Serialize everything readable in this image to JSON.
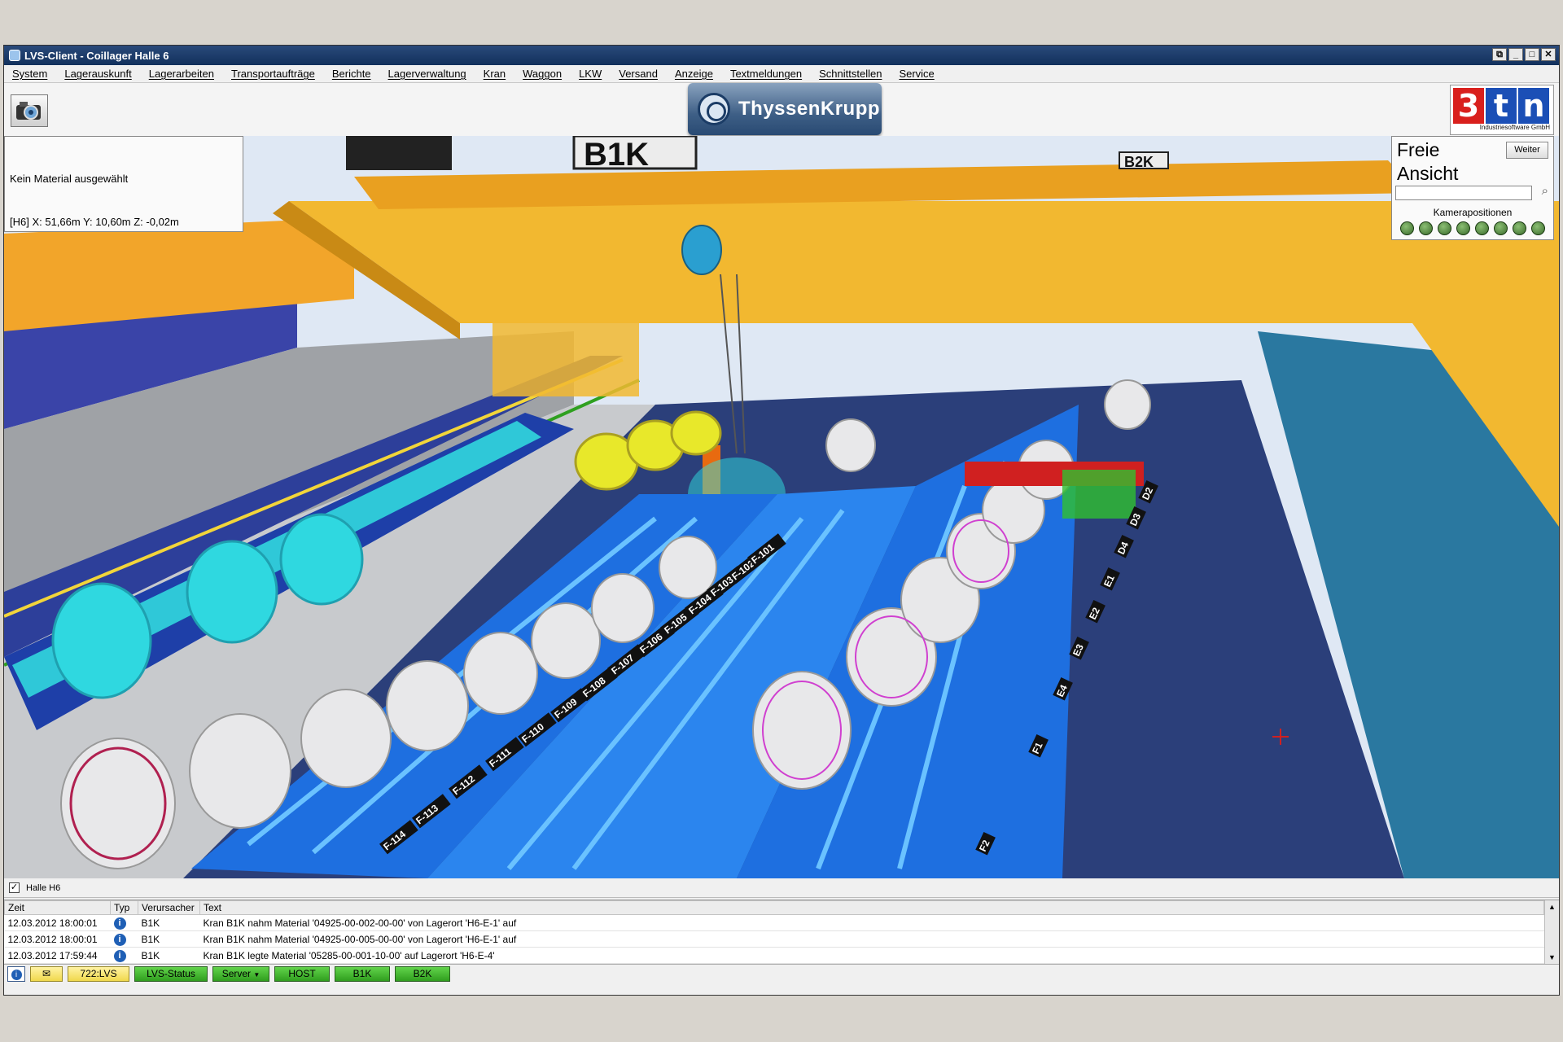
{
  "window": {
    "title": "LVS-Client - Coillager Halle 6",
    "controls": [
      "⧉",
      "_",
      "□",
      "✕"
    ]
  },
  "menu": [
    "System",
    "Lagerauskunft",
    "Lagerarbeiten",
    "Transportaufträge",
    "Berichte",
    "Lagerverwaltung",
    "Kran",
    "Waggon",
    "LKW",
    "Versand",
    "Anzeige",
    "Textmeldungen",
    "Schnittstellen",
    "Service"
  ],
  "toolbar": {
    "brand": "ThyssenKrupp",
    "vendor_letters": [
      "3",
      "t",
      "n"
    ],
    "vendor_subtitle": "Industriesoftware GmbH"
  },
  "info_panel": {
    "message": "Kein Material ausgewählt",
    "coords": "[H6] X: 51,66m Y: 10,60m Z: -0,02m"
  },
  "camera_panel": {
    "title": "Freie Ansicht",
    "next_label": "Weiter",
    "search_value": "",
    "positions_label": "Kamerapositionen",
    "position_count": 8
  },
  "scene": {
    "crane_labels": [
      "B1K",
      "B2K"
    ],
    "row_labels": [
      "F-114",
      "F-113",
      "F-112",
      "F-111",
      "F-110",
      "F-109",
      "F-108",
      "F-107",
      "F-106",
      "F-105",
      "F-104",
      "F-103",
      "F-102",
      "F-101"
    ],
    "right_labels": [
      "F2",
      "F1",
      "E4",
      "E3",
      "E2",
      "E1",
      "D4",
      "D3",
      "D2"
    ],
    "colors": {
      "crane": "#f2b830",
      "floor": "#2b3f7a",
      "rack": "#1e6fe0",
      "coil": "#e8e8ea",
      "selected_coil": "#2fe0e0",
      "highlight_coil": "#e8e82a"
    }
  },
  "layer": {
    "checked": true,
    "label": "Halle H6"
  },
  "log": {
    "columns": [
      "Zeit",
      "Typ",
      "Verursacher",
      "Text"
    ],
    "rows": [
      {
        "time": "12.03.2012 18:00:01",
        "type": "info-icon",
        "source": "B1K",
        "text": "Kran B1K nahm Material '04925-00-002-00-00' von Lagerort 'H6-E-1' auf"
      },
      {
        "time": "12.03.2012 18:00:01",
        "type": "info-icon",
        "source": "B1K",
        "text": "Kran B1K nahm Material '04925-00-005-00-00' von Lagerort 'H6-E-1' auf"
      },
      {
        "time": "12.03.2012 17:59:44",
        "type": "info-icon",
        "source": "B1K",
        "text": "Kran B1K legte Material '05285-00-001-10-00' auf Lagerort 'H6-E-4'"
      }
    ]
  },
  "statusbar": {
    "counter": "722:LVS",
    "lvs_status": "LVS-Status",
    "server": "Server",
    "host": "HOST",
    "crane1": "B1K",
    "crane2": "B2K"
  }
}
